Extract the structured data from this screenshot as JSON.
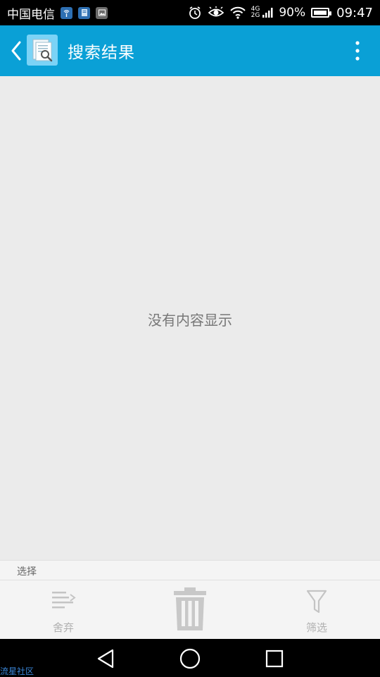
{
  "status_bar": {
    "carrier": "中国电信",
    "network_upper": "4G",
    "network_lower": "2G",
    "battery_percent": "90%",
    "time": "09:47",
    "icons": [
      "wifi-hotspot-icon",
      "app-notification-icon",
      "image-notification-icon",
      "alarm-icon",
      "eye-icon",
      "wifi-icon",
      "signal-icon",
      "battery-icon"
    ]
  },
  "app_bar": {
    "title": "搜索结果",
    "background": "#0aa0d6"
  },
  "content": {
    "empty_message": "没有内容显示"
  },
  "selection": {
    "label": "选择"
  },
  "bottom_toolbar": {
    "discard_label": "舍弃",
    "filter_label": "筛选"
  },
  "watermark": {
    "text": "流星社区"
  }
}
